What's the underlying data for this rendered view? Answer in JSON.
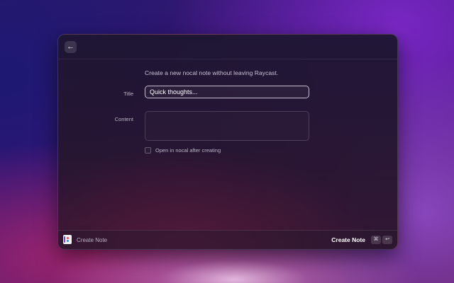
{
  "topbar": {
    "back_icon": "arrow-left-icon",
    "back_glyph": "←"
  },
  "form": {
    "description": "Create a new nocal note without leaving Raycast.",
    "title_label": "Title",
    "title_value": "Quick thoughts...",
    "content_label": "Content",
    "content_value": "",
    "checkbox_label": "Open in nocal after creating",
    "checkbox_checked": false
  },
  "bottombar": {
    "app_icon": "nocal-app-icon",
    "title": "Create Note",
    "action_label": "Create Note",
    "shortcut_cmd": "⌘",
    "shortcut_enter": "↩"
  }
}
